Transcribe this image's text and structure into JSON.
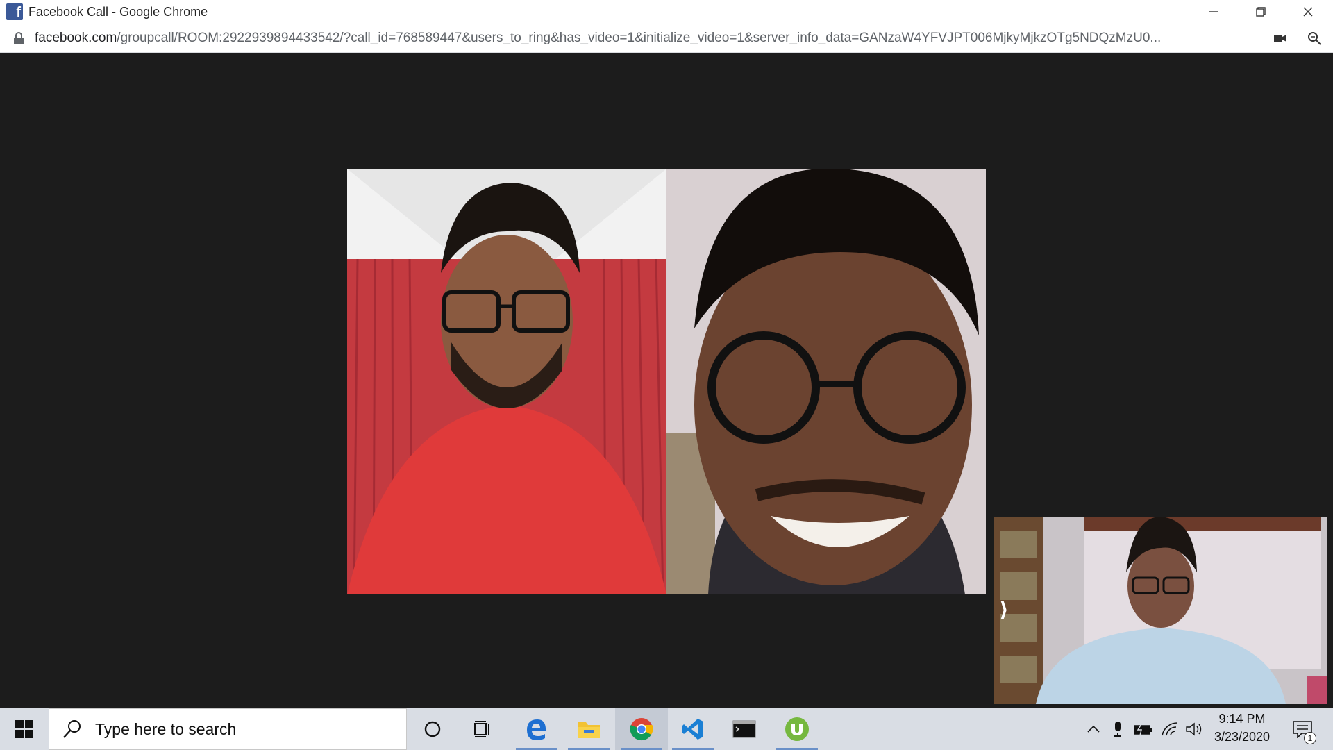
{
  "window": {
    "title": "Facebook Call - Google Chrome",
    "controls": [
      "minimize",
      "restore",
      "close"
    ]
  },
  "addressbar": {
    "host": "facebook.com",
    "path": "/groupcall/ROOM:2922939894433542/?call_id=768589447&users_to_ring&has_video=1&initialize_video=1&server_info_data=GANzaW4YFVJPT006MjkyMjkzOTg5NDQzMzU0..."
  },
  "call": {
    "participants": [
      {
        "name": "participant-1-video",
        "description": "man in red t-shirt with glasses"
      },
      {
        "name": "participant-2-video",
        "description": "man with glasses smiling"
      }
    ],
    "self_view_toggle": "⟩"
  },
  "taskbar": {
    "search_placeholder": "Type here to search",
    "pinned": [
      "cortana-icon",
      "task-view-icon",
      "edge-icon",
      "file-explorer-icon",
      "chrome-icon",
      "vscode-icon",
      "terminal-icon",
      "utorrent-icon"
    ],
    "active_app": "chrome-icon",
    "clock_time": "9:14 PM",
    "clock_date": "3/23/2020",
    "notification_count": "1"
  },
  "colors": {
    "stage_bg": "#1c1c1c",
    "taskbar_bg": "#d9dde4",
    "facebook_blue": "#3b5998"
  }
}
